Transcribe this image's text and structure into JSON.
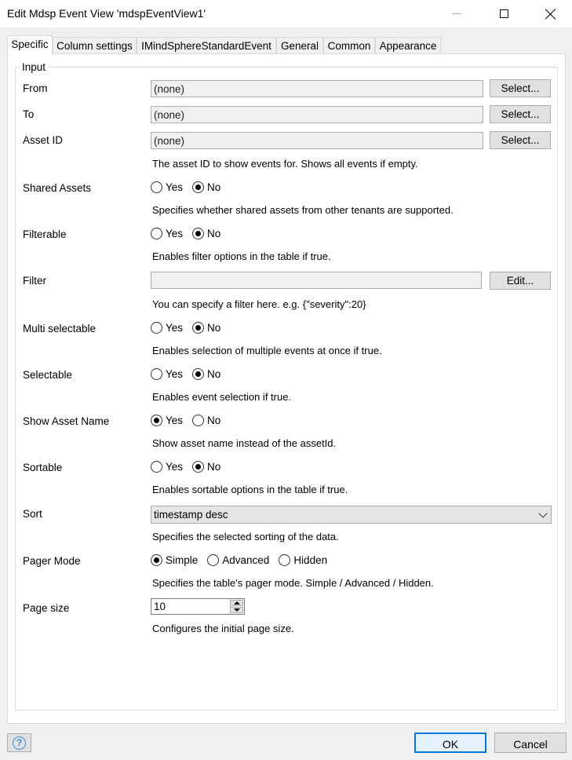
{
  "window": {
    "title": "Edit Mdsp Event View 'mdspEventView1'"
  },
  "tabs": [
    {
      "label": "Specific",
      "active": true
    },
    {
      "label": "Column settings",
      "active": false
    },
    {
      "label": "IMindSphereStandardEvent",
      "active": false
    },
    {
      "label": "General",
      "active": false
    },
    {
      "label": "Common",
      "active": false
    },
    {
      "label": "Appearance",
      "active": false
    }
  ],
  "group": {
    "legend": "Input"
  },
  "fields": {
    "from": {
      "label": "From",
      "value": "(none)",
      "button": "Select..."
    },
    "to": {
      "label": "To",
      "value": "(none)",
      "button": "Select..."
    },
    "asset_id": {
      "label": "Asset ID",
      "value": "(none)",
      "button": "Select...",
      "description": "The asset ID to show events for. Shows all events if empty."
    },
    "shared_assets": {
      "label": "Shared Assets",
      "yes": "Yes",
      "no": "No",
      "selected": "No",
      "description": "Specifies whether shared assets from other tenants are supported."
    },
    "filterable": {
      "label": "Filterable",
      "yes": "Yes",
      "no": "No",
      "selected": "No",
      "description": "Enables filter options in the table if true."
    },
    "filter": {
      "label": "Filter",
      "value": "",
      "button": "Edit...",
      "description": "You can specify a filter here. e.g. {\"severity\":20}"
    },
    "multi_selectable": {
      "label": "Multi selectable",
      "yes": "Yes",
      "no": "No",
      "selected": "No",
      "description": "Enables selection of multiple events at once if true."
    },
    "selectable": {
      "label": "Selectable",
      "yes": "Yes",
      "no": "No",
      "selected": "No",
      "description": "Enables event selection if true."
    },
    "show_asset_name": {
      "label": "Show Asset Name",
      "yes": "Yes",
      "no": "No",
      "selected": "Yes",
      "description": "Show asset name instead of the assetId."
    },
    "sortable": {
      "label": "Sortable",
      "yes": "Yes",
      "no": "No",
      "selected": "No",
      "description": "Enables sortable options in the table if true."
    },
    "sort": {
      "label": "Sort",
      "value": "timestamp desc",
      "description": "Specifies the selected sorting of the data."
    },
    "pager_mode": {
      "label": "Pager Mode",
      "options": [
        "Simple",
        "Advanced",
        "Hidden"
      ],
      "selected": "Simple",
      "description": "Specifies the table's pager mode.  Simple / Advanced / Hidden."
    },
    "page_size": {
      "label": "Page size",
      "value": "10",
      "description": "Configures the initial page size."
    }
  },
  "footer": {
    "help_icon": "question-mark-icon",
    "ok_label": "OK",
    "cancel_label": "Cancel"
  }
}
